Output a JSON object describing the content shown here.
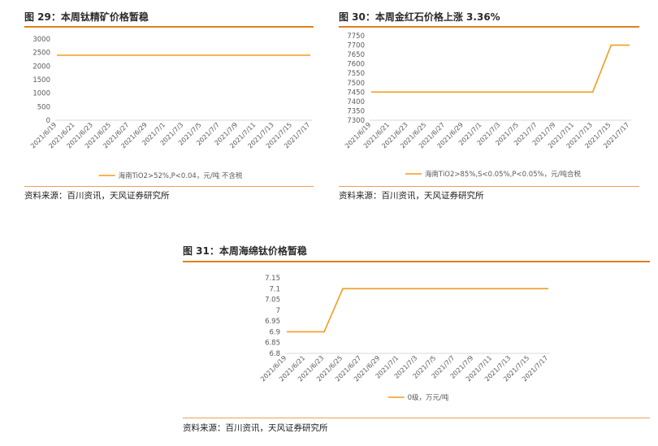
{
  "colors": {
    "accent": "#e0801e",
    "line": "#f39c1e",
    "grid": "#d9d9d9",
    "axis_text": "#595959"
  },
  "source_note": "资料来源：百川资讯，天风证券研究所",
  "charts": [
    {
      "title": "图 29：本周钛精矿价格暂稳",
      "source": "资料来源：百川资讯，天风证券研究所",
      "chart_data": {
        "type": "line",
        "x": [
          "2021/6/19",
          "2021/6/21",
          "2021/6/23",
          "2021/6/25",
          "2021/6/27",
          "2021/6/29",
          "2021/7/1",
          "2021/7/3",
          "2021/7/5",
          "2021/7/7",
          "2021/7/9",
          "2021/7/11",
          "2021/7/13",
          "2021/7/15",
          "2021/7/17"
        ],
        "y_ticks": [
          0,
          500,
          1000,
          1500,
          2000,
          2500,
          3000
        ],
        "y_tick_labels": [
          "0",
          "500",
          "1000",
          "1500",
          "2000",
          "2500",
          "3000"
        ],
        "ylim": [
          0,
          3000
        ],
        "grid": false,
        "legend_position": "bottom",
        "series": [
          {
            "name": "海南TiO2>52%,P<0.04，元/吨 不含税",
            "values": [
              2400,
              2400,
              2400,
              2400,
              2400,
              2400,
              2400,
              2400,
              2400,
              2400,
              2400,
              2400,
              2400,
              2400,
              2400
            ]
          }
        ]
      }
    },
    {
      "title": "图 30：本周金红石价格上涨 3.36%",
      "source": "资料来源：百川资讯，天风证券研究所",
      "chart_data": {
        "type": "line",
        "x": [
          "2021/6/19",
          "2021/6/21",
          "2021/6/23",
          "2021/6/25",
          "2021/6/27",
          "2021/6/29",
          "2021/7/1",
          "2021/7/3",
          "2021/7/5",
          "2021/7/7",
          "2021/7/9",
          "2021/7/11",
          "2021/7/13",
          "2021/7/15",
          "2021/7/17"
        ],
        "y_ticks": [
          7300,
          7350,
          7400,
          7450,
          7500,
          7550,
          7600,
          7650,
          7700,
          7750
        ],
        "y_tick_labels": [
          "7300",
          "7350",
          "7400",
          "7450",
          "7500",
          "7550",
          "7600",
          "7650",
          "7700",
          "7750"
        ],
        "ylim": [
          7300,
          7750
        ],
        "grid": false,
        "legend_position": "bottom",
        "series": [
          {
            "name": "海南TiO2>85%,S<0.05%,P<0.05%，元/吨合税",
            "values": [
              7450,
              7450,
              7450,
              7450,
              7450,
              7450,
              7450,
              7450,
              7450,
              7450,
              7450,
              7450,
              7450,
              7700,
              7700
            ]
          }
        ]
      }
    },
    {
      "title": "图 31：本周海绵钛价格暂稳",
      "source": "资料来源：百川资讯，天风证券研究所",
      "chart_data": {
        "type": "line",
        "x": [
          "2021/6/19",
          "2021/6/21",
          "2021/6/23",
          "2021/6/25",
          "2021/6/27",
          "2021/6/29",
          "2021/7/1",
          "2021/7/3",
          "2021/7/5",
          "2021/7/7",
          "2021/7/9",
          "2021/7/11",
          "2021/7/13",
          "2021/7/15",
          "2021/7/17"
        ],
        "y_ticks": [
          6.8,
          6.85,
          6.9,
          6.95,
          7,
          7.05,
          7.1,
          7.15
        ],
        "y_tick_labels": [
          "6.8",
          "6.85",
          "6.9",
          "6.95",
          "7",
          "7.05",
          "7.1",
          "7.15"
        ],
        "ylim": [
          6.8,
          7.15
        ],
        "grid": false,
        "legend_position": "bottom",
        "series": [
          {
            "name": "0级，万元/吨",
            "values": [
              6.9,
              6.9,
              6.9,
              7.1,
              7.1,
              7.1,
              7.1,
              7.1,
              7.1,
              7.1,
              7.1,
              7.1,
              7.1,
              7.1,
              7.1
            ]
          }
        ]
      }
    }
  ]
}
